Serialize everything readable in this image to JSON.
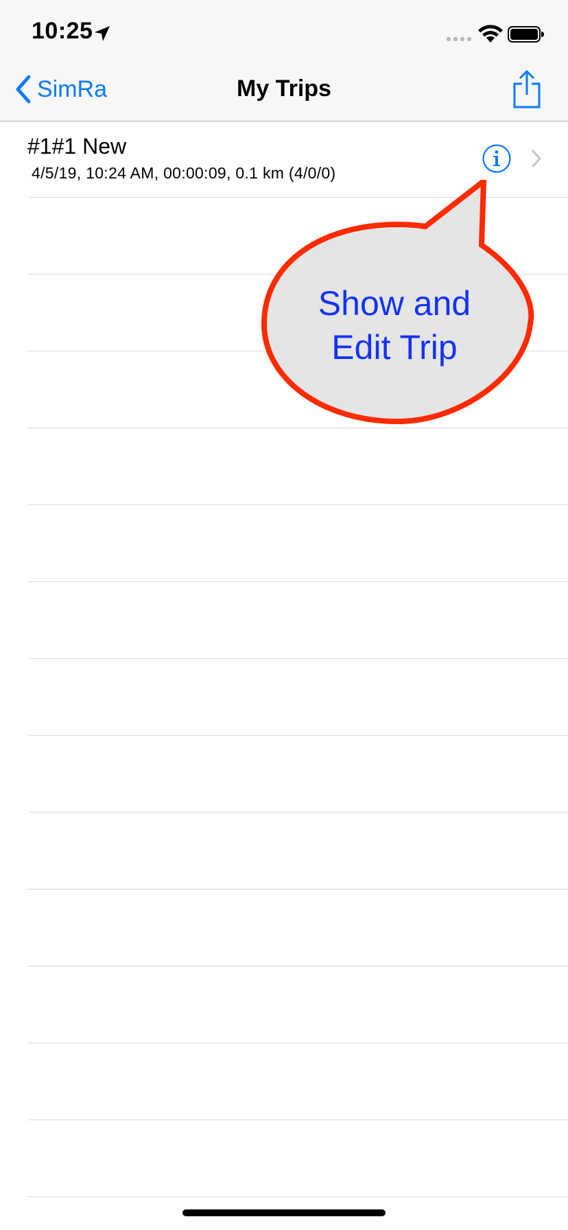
{
  "status_bar": {
    "time": "10:25"
  },
  "nav_bar": {
    "back_label": "SimRa",
    "title": "My Trips"
  },
  "trips": [
    {
      "title": "#1#1 New",
      "subtitle": "4/5/19, 10:24 AM, 00:00:09, 0.1 km (4/0/0)"
    }
  ],
  "callout": {
    "line1": "Show and",
    "line2": "Edit Trip"
  },
  "colors": {
    "accent": "#0a7aff",
    "callout_border": "#ff2a00",
    "callout_fill": "#e5e5e5",
    "callout_text": "#1333f5"
  },
  "icons": {
    "back": "chevron-left-icon",
    "share": "share-icon",
    "info": "info-circle-icon",
    "disclosure": "chevron-right-icon",
    "location": "location-arrow-icon",
    "wifi": "wifi-icon",
    "battery": "battery-icon"
  }
}
